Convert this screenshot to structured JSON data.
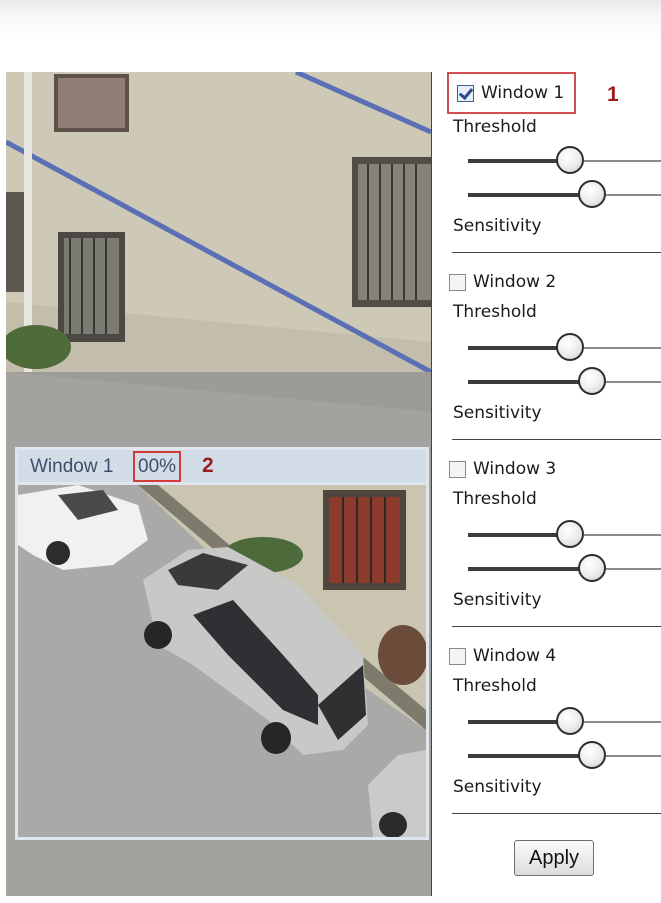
{
  "detection_overlay": {
    "title": "Window 1",
    "percent": "00%",
    "marker": "2"
  },
  "windows": [
    {
      "label": "Window 1",
      "checked": true,
      "marker": "1",
      "threshold_label": "Threshold",
      "sensitivity_label": "Sensitivity",
      "threshold_value": 0.53,
      "sensitivity_value": 0.64
    },
    {
      "label": "Window 2",
      "checked": false,
      "threshold_label": "Threshold",
      "sensitivity_label": "Sensitivity",
      "threshold_value": 0.53,
      "sensitivity_value": 0.64
    },
    {
      "label": "Window 3",
      "checked": false,
      "threshold_label": "Threshold",
      "sensitivity_label": "Sensitivity",
      "threshold_value": 0.53,
      "sensitivity_value": 0.64
    },
    {
      "label": "Window 4",
      "checked": false,
      "threshold_label": "Threshold",
      "sensitivity_label": "Sensitivity",
      "threshold_value": 0.53,
      "sensitivity_value": 0.64
    }
  ],
  "apply_label": "Apply",
  "colors": {
    "highlight_border": "#d24d4d",
    "marker_text": "#9b1b1b",
    "overlay_header": "#d2dde8"
  }
}
